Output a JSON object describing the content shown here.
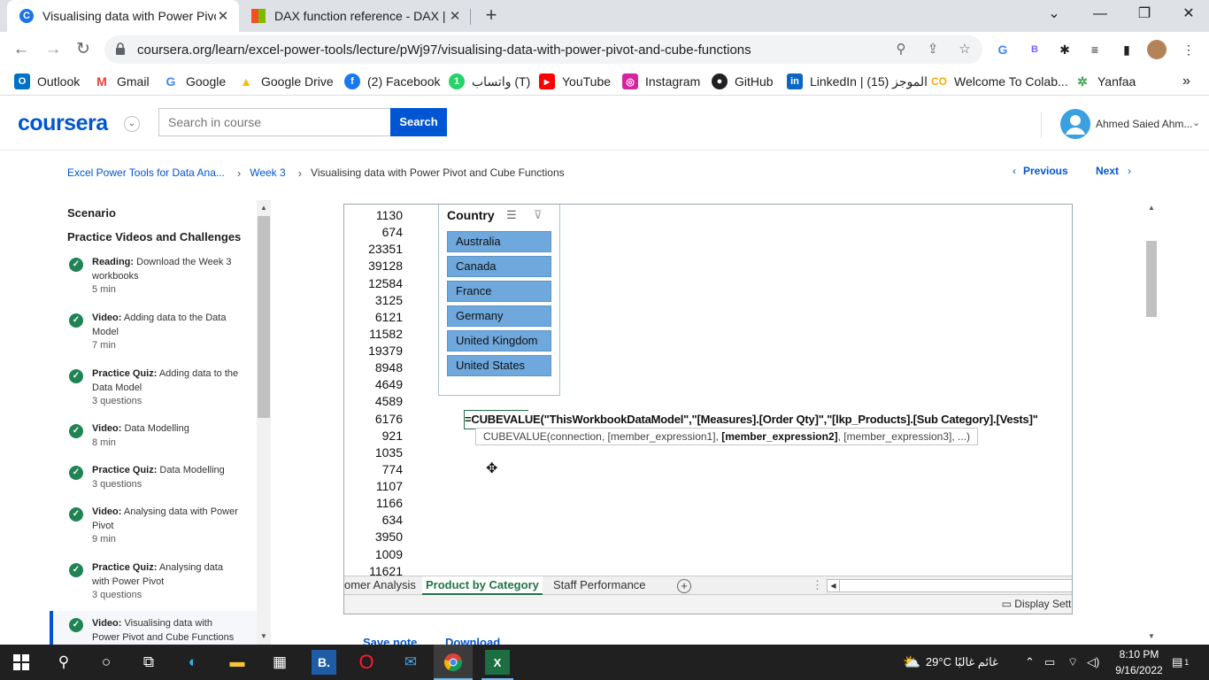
{
  "browser": {
    "tabs": [
      {
        "title": "Visualising data with Power Pivot",
        "active": true
      },
      {
        "title": "DAX function reference - DAX | M",
        "active": false
      }
    ],
    "url": "coursera.org/learn/excel-power-tools/lecture/pWj97/visualising-data-with-power-pivot-and-cube-functions",
    "bookmarks": [
      "Outlook",
      "Gmail",
      "Google",
      "Google Drive",
      "(2) Facebook",
      "واتساب (T)",
      "YouTube",
      "Instagram",
      "GitHub",
      "LinkedIn | الموجز (15)",
      "Welcome To Colab...",
      "Yanfaa"
    ],
    "bookmarks_more": "»"
  },
  "header": {
    "logo": "coursera",
    "search_placeholder": "Search in course",
    "search_button": "Search",
    "user_name": "Ahmed Saied Ahm..."
  },
  "breadcrumb": {
    "course": "Excel Power Tools for Data Ana...",
    "week": "Week 3",
    "lecture": "Visualising data with Power Pivot and Cube Functions",
    "previous": "Previous",
    "next": "Next"
  },
  "sidebar": {
    "section": "Scenario",
    "group": "Practice Videos and Challenges",
    "items": [
      {
        "kind": "Reading:",
        "title": "Download the Week 3 workbooks",
        "meta": "5 min"
      },
      {
        "kind": "Video:",
        "title": "Adding data to the Data Model",
        "meta": "7 min"
      },
      {
        "kind": "Practice Quiz:",
        "title": "Adding data to the Data Model",
        "meta": "3 questions"
      },
      {
        "kind": "Video:",
        "title": "Data Modelling",
        "meta": "8 min"
      },
      {
        "kind": "Practice Quiz:",
        "title": "Data Modelling",
        "meta": "3 questions"
      },
      {
        "kind": "Video:",
        "title": "Analysing data with Power Pivot",
        "meta": "9 min"
      },
      {
        "kind": "Practice Quiz:",
        "title": "Analysing data with Power Pivot",
        "meta": "3 questions"
      },
      {
        "kind": "Video:",
        "title": "Visualising data with Power Pivot and Cube Functions",
        "meta": ""
      }
    ]
  },
  "excel": {
    "numbers": [
      "1130",
      "674",
      "23351",
      "39128",
      "12584",
      "3125",
      "6121",
      "11582",
      "19379",
      "8948",
      "4649",
      "4589",
      "6176",
      "921",
      "1035",
      "774",
      "1107",
      "1166",
      "634",
      "3950",
      "1009",
      "11621"
    ],
    "slicer": {
      "title": "Country",
      "items": [
        "Australia",
        "Canada",
        "France",
        "Germany",
        "United Kingdom",
        "United States"
      ]
    },
    "formula": "=CUBEVALUE(\"ThisWorkbookDataModel\",\"[Measures].[Order Qty]\",\"[lkp_Products].[Sub Category].[Vests]\"",
    "tooltip_pre": "CUBEVALUE(connection, [member_expression1], ",
    "tooltip_bold": "[member_expression2]",
    "tooltip_post": ", [member_expression3], ...)",
    "sheet_tabs": [
      "omer Analysis",
      "Product by Category",
      "Staff Performance"
    ],
    "active_sheet": "Product by Category",
    "display_settings": "Display Setti"
  },
  "below_video": {
    "save_note": "Save note",
    "download": "Download"
  },
  "taskbar": {
    "weather": "29°C  غائم غالبًا",
    "time": "8:10 PM",
    "date": "9/16/2022",
    "notifications": "1"
  }
}
